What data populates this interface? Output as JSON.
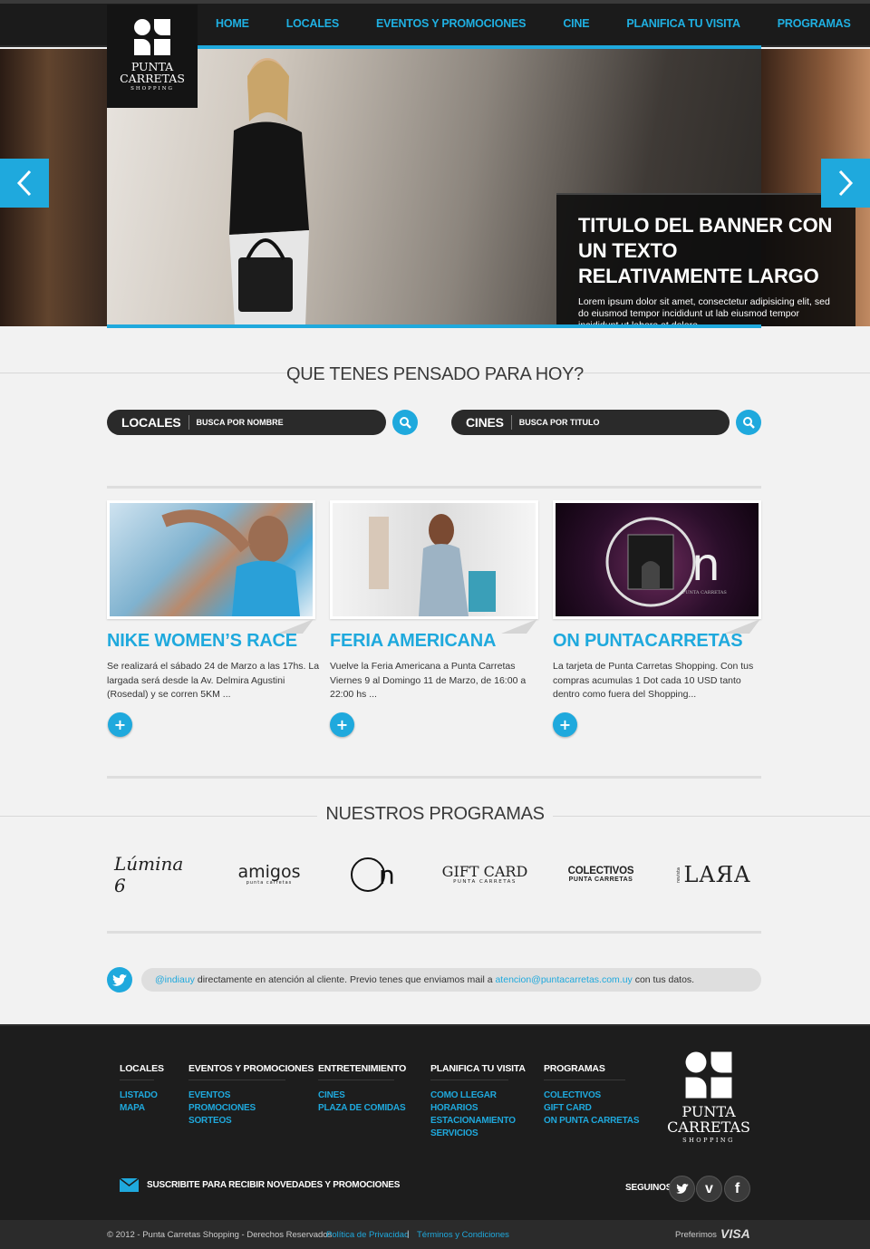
{
  "colors": {
    "accent": "#1fa9dd",
    "dark": "#1b1b1b",
    "footer": "#1d1d1d",
    "background": "#f2f2f2"
  },
  "logo": {
    "name_line1": "PUNTA",
    "name_line2": "CARRETAS",
    "tagline": "SHOPPING"
  },
  "nav": {
    "items": [
      "HOME",
      "LOCALES",
      "EVENTOS Y PROMOCIONES",
      "CINE",
      "PLANIFICA TU VISITA",
      "PROGRAMAS"
    ]
  },
  "hero": {
    "title": "TITULO DEL BANNER CON UN TEXTO RELATIVAMENTE LARGO",
    "text": "Lorem ipsum dolor sit amet, consectetur adipisicing elit, sed do eiusmod tempor incididunt ut lab eiusmod tempor incididunt ut labore et dolore.",
    "prev_icon": "chevron-left-icon",
    "next_icon": "chevron-right-icon"
  },
  "search": {
    "heading": "QUE TENES PENSADO PARA HOY?",
    "locales": {
      "label": "LOCALES",
      "placeholder": "BUSCA POR NOMBRE"
    },
    "cines": {
      "label": "CINES",
      "placeholder": "BUSCA POR TITULO"
    }
  },
  "cards": [
    {
      "title": "NIKE WOMEN’S RACE",
      "text": "Se realizará el sábado 24 de Marzo  a las 17hs. La largada será desde la Av. Delmira Agustini (Rosedal) y se corren 5KM ...",
      "more": "+"
    },
    {
      "title": "FERIA AMERICANA",
      "text": "Vuelve la Feria Americana a Punta Carretas Viernes 9 al Domingo 11 de Marzo, de 16:00 a 22:00 hs ...",
      "more": "+"
    },
    {
      "title": "ON PUNTACARRETAS",
      "text": "La tarjeta de Punta Carretas Shopping. Con tus compras acumulas 1 Dot cada 10 USD tanto dentro como fuera del Shopping...",
      "more": "+"
    }
  ],
  "on_card_image": {
    "brand": "n",
    "subtitle": "PUNTA CARRETAS"
  },
  "programs": {
    "heading": "NUESTROS PROGRAMAS",
    "logos": [
      {
        "name": "Lumina6",
        "text": "Lúmina 6"
      },
      {
        "name": "Amigos",
        "text": "amigos",
        "sub": "punta carretas"
      },
      {
        "name": "On",
        "text": "n"
      },
      {
        "name": "GiftCard",
        "text": "GIFT CARD",
        "sub": "PUNTA CARRETAS"
      },
      {
        "name": "Colectivos",
        "text": "COLECTIVOS",
        "sub": "PUNTA CARRETAS"
      },
      {
        "name": "Lara",
        "text": "LAЯA",
        "sub": "revista"
      }
    ]
  },
  "twitter": {
    "handle": "@indiauy",
    "message": " directamente en atención al cliente. Previo tenes que enviamos mail a ",
    "email": "atencion@puntacarretas.com.uy",
    "suffix": " con tus datos."
  },
  "footer": {
    "columns": [
      {
        "heading": "LOCALES",
        "links": [
          "LISTADO",
          "MAPA"
        ]
      },
      {
        "heading": "EVENTOS Y PROMOCIONES",
        "links": [
          "EVENTOS",
          "PROMOCIONES",
          "SORTEOS"
        ]
      },
      {
        "heading": "ENTRETENIMIENTO",
        "links": [
          "CINES",
          "PLAZA DE COMIDAS"
        ]
      },
      {
        "heading": "PLANIFICA TU VISITA",
        "links": [
          "COMO LLEGAR",
          "HORARIOS",
          "ESTACIONAMIENTO",
          "SERVICIOS"
        ]
      },
      {
        "heading": "PROGRAMAS",
        "links": [
          "COLECTIVOS",
          "GIFT CARD",
          "ON PUNTA CARRETAS"
        ]
      }
    ],
    "logo": {
      "line1": "PUNTA",
      "line2": "CARRETAS",
      "tagline": "SHOPPING"
    },
    "newsletter": "SUSCRIBITE PARA RECIBIR NOVEDADES Y PROMOCIONES",
    "follow": "SEGUINOS",
    "social": [
      "twitter-icon",
      "vimeo-icon",
      "facebook-icon"
    ],
    "social_glyphs": [
      "🐦",
      "v",
      "f"
    ],
    "copyright": "© 2012 - Punta Carretas Shopping - Derechos Reservados",
    "privacy": "Política de Privacidad",
    "divider": "|",
    "terms": "Términos y Condiciones",
    "preferred": "Preferimos",
    "card_brand": "VISA"
  }
}
